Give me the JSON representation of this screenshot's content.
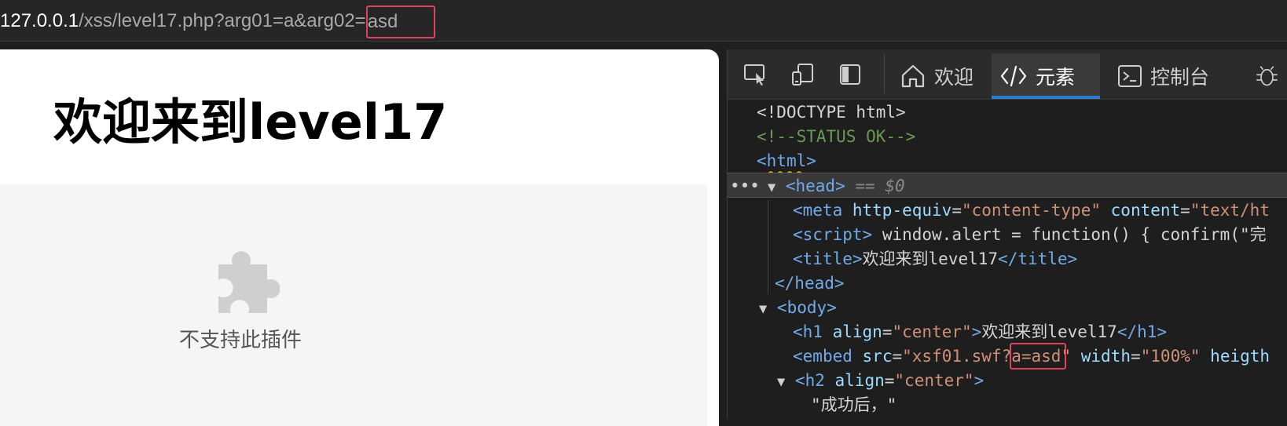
{
  "address_bar": {
    "host": "127.0.0.1",
    "path": "/xss/level17.php?arg01=a&arg02=",
    "highlighted_value": "asd"
  },
  "page": {
    "title": "欢迎来到level17",
    "plugin_icon": "puzzle-piece-icon",
    "plugin_message": "不支持此插件"
  },
  "devtools": {
    "toolbar_icons": [
      "inspect-icon",
      "device-emulation-icon",
      "dock-side-icon"
    ],
    "tabs": [
      {
        "label": "欢迎",
        "icon": "home-icon",
        "active": false
      },
      {
        "label": "元素",
        "icon": "code-icon",
        "active": true
      },
      {
        "label": "控制台",
        "icon": "console-icon",
        "active": false
      },
      {
        "label": "",
        "icon": "bug-icon",
        "active": false
      }
    ],
    "dom": {
      "doctype": "<!DOCTYPE html>",
      "comment": "<!--STATUS OK-->",
      "html_tag": "html",
      "head_tag": "head",
      "head_marker": "== $0",
      "ellipsis": "•••",
      "meta_attr1": "http-equiv",
      "meta_val1": "content-type",
      "meta_attr2": "content",
      "meta_val2_partial": "\"text/ht",
      "script_tag": "script",
      "script_text_partial": " window.alert = function() { confirm(\"完",
      "title_tag": "title",
      "title_text": "欢迎来到level17",
      "head_close": "/head",
      "body_tag": "body",
      "h1_tag": "h1",
      "h1_attr": "align",
      "h1_val": "center",
      "h1_text": "欢迎来到level17",
      "embed_tag": "embed",
      "embed_attr_src": "src",
      "embed_src_prefix": "xsf01.swf?",
      "embed_src_highlight": "a=asd",
      "embed_attr_width": "width",
      "embed_width_val": "100%",
      "embed_attr_height_partial": "heigth",
      "h2_tag": "h2",
      "h2_attr": "align",
      "h2_val": "center",
      "h2_text_partial": "\"成功后，\""
    }
  },
  "colors": {
    "highlight_border": "#e0415c",
    "active_tab_underline": "#2e7ad1",
    "tag_color": "#72a9e8",
    "attr_value_color": "#ce9178",
    "comment_color": "#6a9955"
  }
}
